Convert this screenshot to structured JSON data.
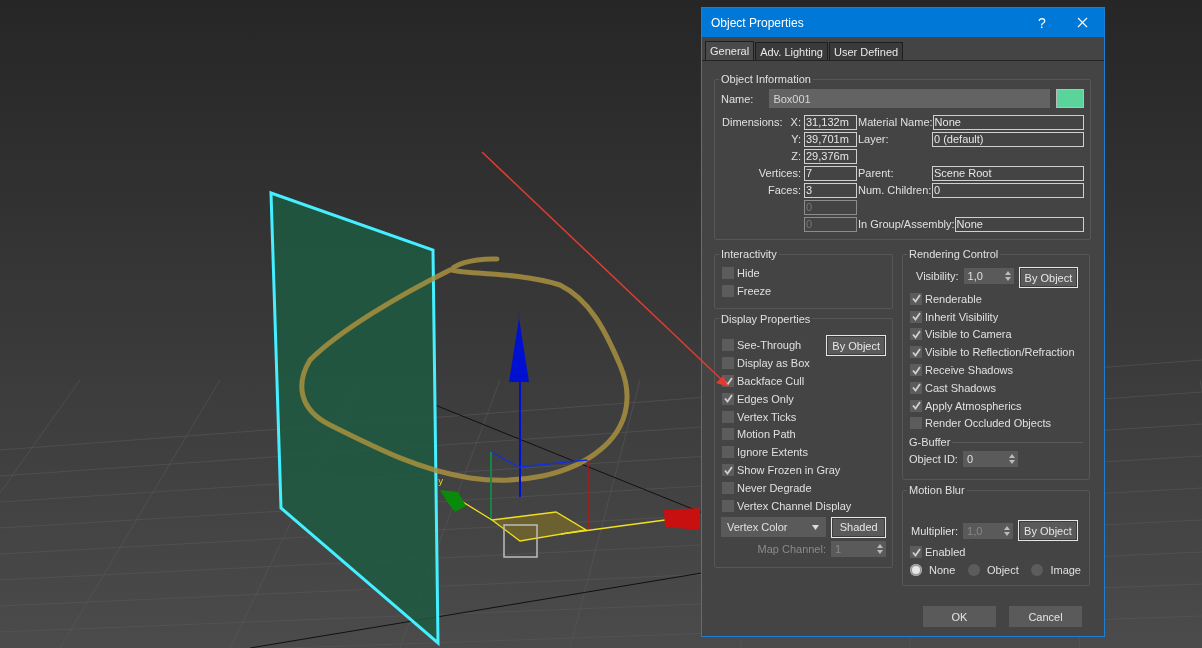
{
  "viewport": {
    "axis_labels": [
      "z",
      "y"
    ]
  },
  "dialog": {
    "title": "Object Properties",
    "help": "?",
    "tabs": [
      {
        "label": "General",
        "selected": true
      },
      {
        "label": "Adv. Lighting",
        "selected": false
      },
      {
        "label": "User Defined",
        "selected": false
      }
    ],
    "object_information": {
      "title": "Object Information",
      "name_label": "Name:",
      "name_value": "Box001",
      "color": "#5ad49a",
      "rows": [
        {
          "lead": "Dimensions:",
          "label": "X:",
          "value": "31,132m",
          "disabled": false,
          "right_label": "Material Name:",
          "right_value": "None"
        },
        {
          "label": "Y:",
          "value": "39,701m",
          "disabled": false,
          "right_label": "Layer:",
          "right_value": "0 (default)"
        },
        {
          "label": "Z:",
          "value": "29,376m",
          "disabled": false
        },
        {
          "label": "Vertices:",
          "value": "7",
          "disabled": false,
          "right_label": "Parent:",
          "right_value": "Scene Root"
        },
        {
          "label": "Faces:",
          "value": "3",
          "disabled": false,
          "right_label": "Num. Children:",
          "right_value": "0"
        },
        {
          "value": "0",
          "disabled": true
        },
        {
          "value": "0",
          "disabled": true,
          "right_label": "In Group/Assembly:",
          "right_value": "None"
        }
      ]
    },
    "interactivity": {
      "title": "Interactivity",
      "options": [
        {
          "label": "Hide",
          "checked": false
        },
        {
          "label": "Freeze",
          "checked": false
        }
      ]
    },
    "display_properties": {
      "title": "Display Properties",
      "by_object_button": "By Object",
      "options": [
        {
          "label": "See-Through",
          "checked": false
        },
        {
          "label": "Display as Box",
          "checked": false
        },
        {
          "label": "Backface Cull",
          "checked": true
        },
        {
          "label": "Edges Only",
          "checked": true
        },
        {
          "label": "Vertex Ticks",
          "checked": false
        },
        {
          "label": "Motion Path",
          "checked": false
        },
        {
          "label": "Ignore Extents",
          "checked": false
        },
        {
          "label": "Show Frozen in Gray",
          "checked": true
        },
        {
          "label": "Never Degrade",
          "checked": false
        },
        {
          "label": "Vertex Channel Display",
          "checked": false
        }
      ],
      "vertex_dropdown": "Vertex Color",
      "shaded_button": "Shaded",
      "map_channel_label": "Map Channel:",
      "map_channel_value": "1",
      "map_channel_disabled": true
    },
    "rendering_control": {
      "title": "Rendering Control",
      "visibility_label": "Visibility:",
      "visibility_value": "1,0",
      "by_object_button": "By Object",
      "options": [
        {
          "label": "Renderable",
          "checked": true
        },
        {
          "label": "Inherit Visibility",
          "checked": true
        },
        {
          "label": "Visible to Camera",
          "checked": true
        },
        {
          "label": "Visible to Reflection/Refraction",
          "checked": true
        },
        {
          "label": "Receive Shadows",
          "checked": true
        },
        {
          "label": "Cast Shadows",
          "checked": true
        },
        {
          "label": "Apply Atmospherics",
          "checked": true
        },
        {
          "label": "Render Occluded Objects",
          "checked": false
        }
      ],
      "gbuffer_title": "G-Buffer",
      "object_id_label": "Object ID:",
      "object_id_value": "0"
    },
    "motion_blur": {
      "title": "Motion Blur",
      "multiplier_label": "Multiplier:",
      "multiplier_value": "1,0",
      "multiplier_disabled": true,
      "by_object_button": "By Object",
      "enabled": {
        "label": "Enabled",
        "checked": true
      },
      "modes": [
        {
          "label": "None",
          "selected": true
        },
        {
          "label": "Object",
          "selected": false
        },
        {
          "label": "Image",
          "selected": false
        }
      ]
    },
    "buttons": [
      "OK",
      "Cancel"
    ]
  }
}
